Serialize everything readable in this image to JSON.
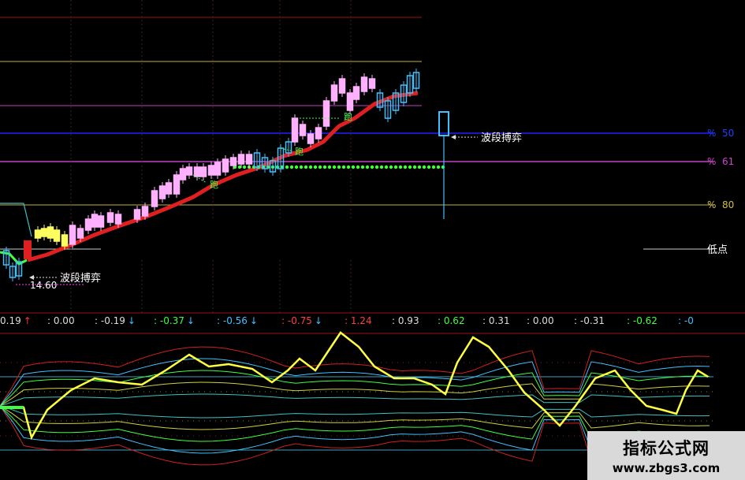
{
  "labels": {
    "wave_upper": "波段搏弈",
    "wave_lower": "波段搏弈",
    "run_marker": "跑",
    "low_point": "低点",
    "price_low": "14.60",
    "pct_50": "50",
    "pct_61": "61",
    "pct_80": "80",
    "pct_sign": "%"
  },
  "indicator_values": [
    {
      "text": "0.19",
      "arrow": "↑",
      "color": "#dddddd",
      "arrow_color": "#ff3030"
    },
    {
      "text": ": 0.00",
      "arrow": "",
      "color": "#dddddd",
      "arrow_color": ""
    },
    {
      "text": ": -0.19",
      "arrow": "↓",
      "color": "#dddddd",
      "arrow_color": "#40c0ff"
    },
    {
      "text": ": -0.37",
      "arrow": "↓",
      "color": "#40ff40",
      "arrow_color": "#40c0ff"
    },
    {
      "text": ": -0.56",
      "arrow": "↓",
      "color": "#40c0ff",
      "arrow_color": "#40c0ff"
    },
    {
      "text": ": -0.75",
      "arrow": "↓",
      "color": "#ff4040",
      "arrow_color": "#40c0ff"
    },
    {
      "text": ": 1.24",
      "arrow": "",
      "color": "#ff4040",
      "arrow_color": ""
    },
    {
      "text": ": 0.93",
      "arrow": "",
      "color": "#dddddd",
      "arrow_color": ""
    },
    {
      "text": ": 0.62",
      "arrow": "",
      "color": "#40ff40",
      "arrow_color": ""
    },
    {
      "text": ": 0.31",
      "arrow": "",
      "color": "#dddddd",
      "arrow_color": ""
    },
    {
      "text": ": 0.00",
      "arrow": "",
      "color": "#dddddd",
      "arrow_color": ""
    },
    {
      "text": ": -0.31",
      "arrow": "",
      "color": "#dddddd",
      "arrow_color": ""
    },
    {
      "text": ": -0.62",
      "arrow": "",
      "color": "#40ff40",
      "arrow_color": ""
    },
    {
      "text": ": -0",
      "arrow": "",
      "color": "#40c0ff",
      "arrow_color": ""
    }
  ],
  "watermark": {
    "title": "指标公式网",
    "url": "www.zbgs3.com"
  },
  "colors": {
    "background": "#000000",
    "candle_up": "#ffb0ff",
    "candle_down": "#40c0ff",
    "candle_yellow": "#ffff60",
    "trend_line": "#e02020",
    "fib_blue": "#2020ff",
    "fib_magenta": "#d040d0",
    "fib_yellow": "#d0c040",
    "grid_red": "#a01010",
    "osc_yellow": "#ffff40"
  }
}
